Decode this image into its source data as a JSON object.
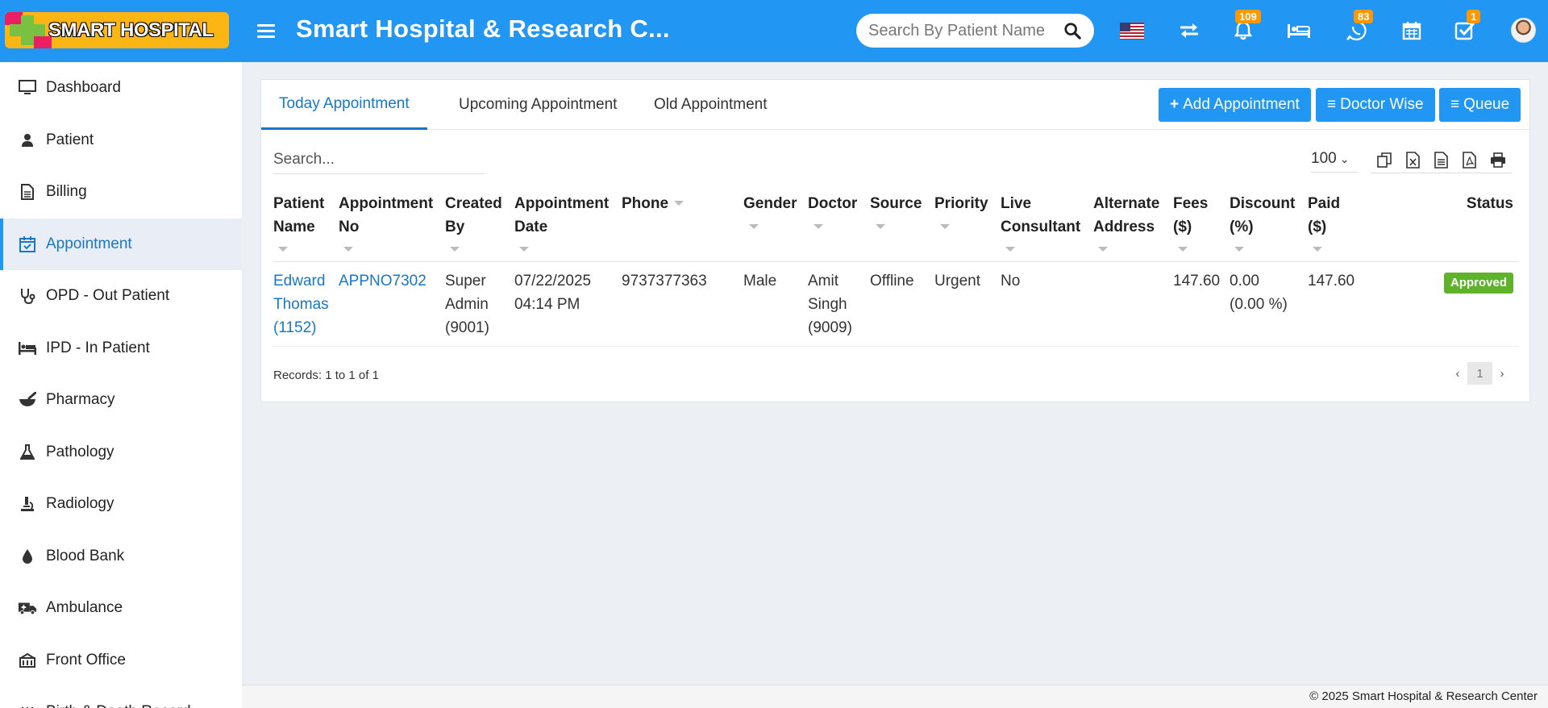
{
  "header": {
    "logo_text": "SMART HOSPITAL",
    "title": "Smart Hospital & Research C...",
    "search_placeholder": "Search By Patient Name",
    "notifications_count": "109",
    "whatsapp_count": "83",
    "tasks_count": "1",
    "icons": [
      "flag-us-icon",
      "switch-icon",
      "bell-icon",
      "bed-icon",
      "whatsapp-icon",
      "calendar-icon",
      "task-check-icon",
      "user-avatar"
    ]
  },
  "sidebar": {
    "items": [
      {
        "label": "Dashboard",
        "icon": "monitor-icon"
      },
      {
        "label": "Patient",
        "icon": "user-icon"
      },
      {
        "label": "Billing",
        "icon": "file-text-icon"
      },
      {
        "label": "Appointment",
        "icon": "calendar-check-icon"
      },
      {
        "label": "OPD - Out Patient",
        "icon": "stethoscope-icon"
      },
      {
        "label": "IPD - In Patient",
        "icon": "procedure-bed-icon"
      },
      {
        "label": "Pharmacy",
        "icon": "mortar-pestle-icon"
      },
      {
        "label": "Pathology",
        "icon": "flask-icon"
      },
      {
        "label": "Radiology",
        "icon": "microscope-icon"
      },
      {
        "label": "Blood Bank",
        "icon": "tint-icon"
      },
      {
        "label": "Ambulance",
        "icon": "ambulance-icon"
      },
      {
        "label": "Front Office",
        "icon": "dumpster-icon"
      },
      {
        "label": "Birth & Death Record",
        "icon": "birth-death-icon"
      }
    ],
    "active_index": 3
  },
  "tabs": [
    "Today Appointment",
    "Upcoming Appointment",
    "Old Appointment"
  ],
  "buttons": {
    "add_appointment": "Add Appointment",
    "doctor_wise": "Doctor Wise",
    "queue": "Queue"
  },
  "table_controls": {
    "search_placeholder": "Search...",
    "page_length": "100",
    "export_icons": [
      "copy-icon",
      "excel-icon",
      "csv-icon",
      "pdf-icon",
      "print-icon"
    ]
  },
  "table": {
    "columns": [
      [
        "Patient",
        "Name"
      ],
      [
        "Appointment",
        "No"
      ],
      [
        "Created",
        "By"
      ],
      [
        "Appointment",
        "Date"
      ],
      [
        "Phone"
      ],
      [
        "Gender"
      ],
      [
        "Doctor"
      ],
      [
        "Source"
      ],
      [
        "Priority"
      ],
      [
        "Live",
        "Consultant"
      ],
      [
        "Alternate",
        "Address"
      ],
      [
        "Fees",
        "($)"
      ],
      [
        "Discount",
        "(%)"
      ],
      [
        "Paid",
        "($)"
      ],
      [
        "Status"
      ]
    ],
    "rows": [
      {
        "patient_name": [
          "Edward",
          "Thomas",
          "(1152)"
        ],
        "appointment_no": "APPNO7302",
        "created_by": [
          "Super",
          "Admin",
          "(9001)"
        ],
        "appointment_date": [
          "07/22/2025",
          "04:14 PM"
        ],
        "phone": "9737377363",
        "gender": "Male",
        "doctor": [
          "Amit",
          "Singh",
          "(9009)"
        ],
        "source": "Offline",
        "priority": "Urgent",
        "live_consultant": "No",
        "alternate_address": "",
        "fees": "147.60",
        "discount": [
          "0.00",
          "(0.00 %)"
        ],
        "paid": "147.60",
        "status": "Approved"
      }
    ]
  },
  "footer_records": "Records: 1 to 1 of 1",
  "pagination": {
    "prev": "‹",
    "current": "1",
    "next": "›"
  },
  "footer": "© 2025 Smart Hospital & Research Center",
  "colors": {
    "header_bg": "#2196f3",
    "active_link": "#1877c6",
    "approved_badge": "#5fb32a",
    "badge_orange": "#ff9800"
  }
}
